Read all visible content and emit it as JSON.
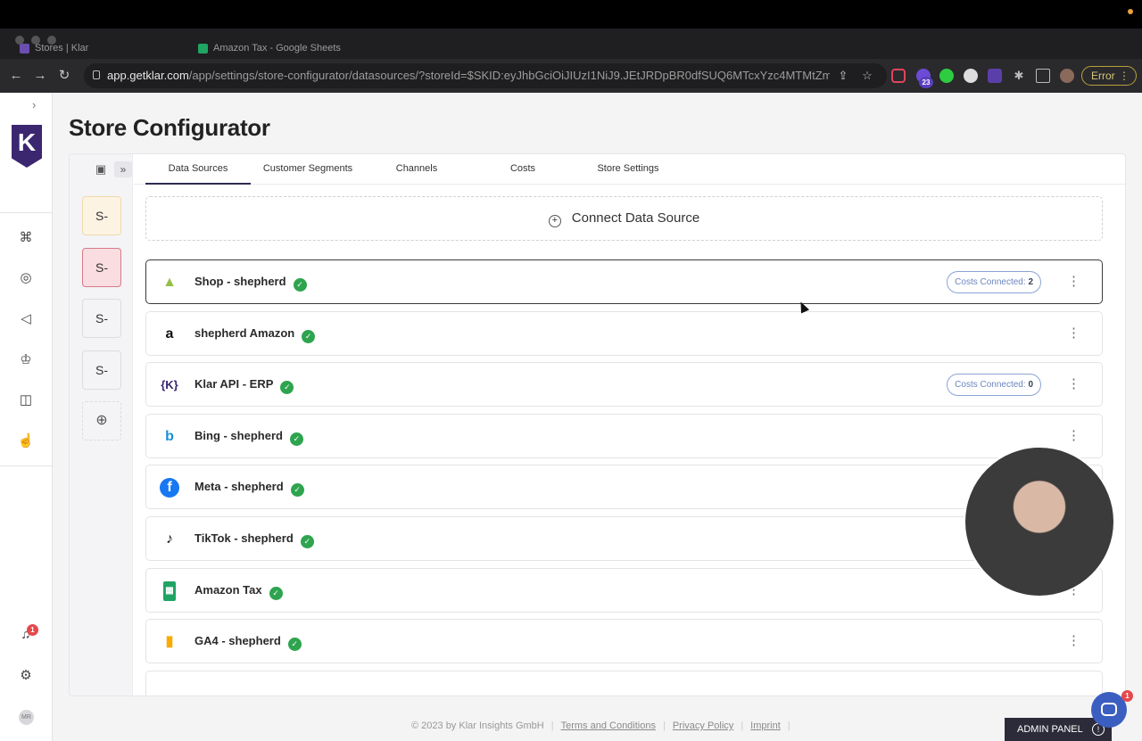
{
  "browser": {
    "tabs": [
      {
        "label": "Stores | Klar"
      },
      {
        "label": "Amazon Tax - Google Sheets"
      }
    ],
    "url_host": "app.getklar.com",
    "url_path": "/app/settings/store-configurator/datasources/?storeId=$SKID:eyJhbGciOiJIUzI1NiJ9.JEtJRDpBR0dfSUQ6MTcxYzc4MTMtZmR...",
    "extension_badge": "23",
    "error_label": "Error"
  },
  "rail": {
    "logo_text": "K",
    "notification_count": "1",
    "avatar_initials": "MR"
  },
  "page": {
    "title": "Store Configurator"
  },
  "stores": [
    "S-",
    "S-",
    "S-",
    "S-"
  ],
  "tabs": [
    {
      "label": "Data Sources",
      "active": true
    },
    {
      "label": "Customer Segments",
      "active": false
    },
    {
      "label": "Channels",
      "active": false
    },
    {
      "label": "Costs",
      "active": false
    },
    {
      "label": "Store Settings",
      "active": false
    }
  ],
  "connect_label": "Connect Data Source",
  "costs_label": "Costs Connected:",
  "data_sources": [
    {
      "name": "Shop - shepherd",
      "icon": "shopify-icon",
      "costs": "2"
    },
    {
      "name": "shepherd Amazon",
      "icon": "amazon-icon",
      "costs": null
    },
    {
      "name": "Klar API - ERP",
      "icon": "klar-api-icon",
      "costs": "0"
    },
    {
      "name": "Bing - shepherd",
      "icon": "bing-icon",
      "costs": null
    },
    {
      "name": "Meta - shepherd",
      "icon": "facebook-icon",
      "costs": null
    },
    {
      "name": "TikTok - shepherd",
      "icon": "tiktok-icon",
      "costs": null
    },
    {
      "name": "Amazon Tax",
      "icon": "google-sheets-icon",
      "costs": null
    },
    {
      "name": "GA4 - shepherd",
      "icon": "google-analytics-icon",
      "costs": null
    }
  ],
  "footer": {
    "copyright": "© 2023 by Klar Insights GmbH",
    "terms": "Terms and Conditions",
    "privacy": "Privacy Policy",
    "imprint": "Imprint"
  },
  "admin_panel": "ADMIN PANEL",
  "chat_badge": "1",
  "colors": {
    "brand": "#3b2670",
    "success": "#2ea44f",
    "link": "#6b86bf"
  }
}
